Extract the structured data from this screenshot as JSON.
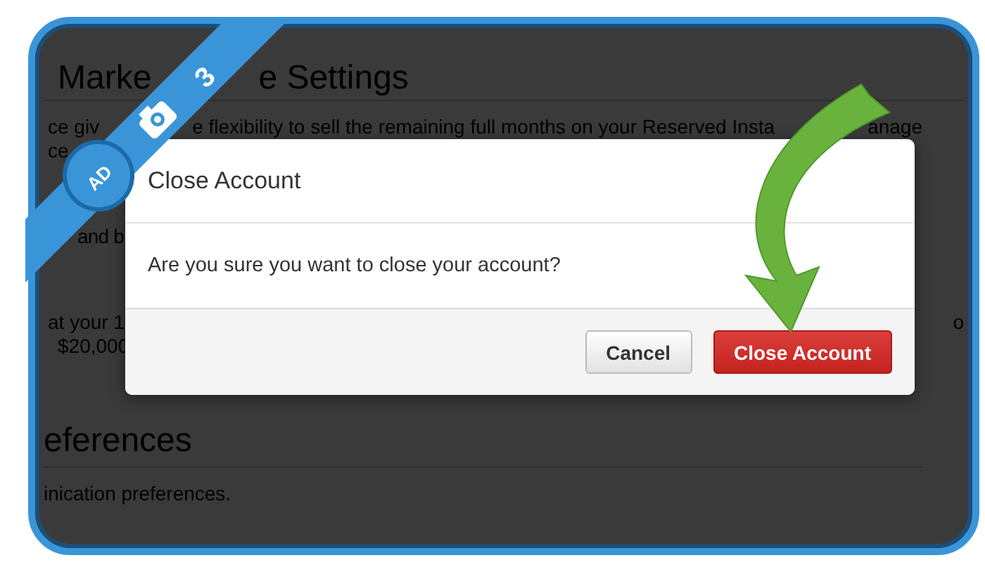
{
  "background_page": {
    "heading_fragments": [
      "Marke",
      "e Settings"
    ],
    "line_1_fragments": [
      "ce giv",
      "e flexibility to sell the remaining full months on your Reserved Insta",
      "anage"
    ],
    "line_2_fragments": [
      "ce"
    ],
    "line_3_fragments": [
      "and b"
    ],
    "line_4_fragments": [
      "at your 1",
      "o"
    ],
    "line_5_fragments": [
      "$20,000"
    ],
    "section_heading": "eferences",
    "section_text": "inication preferences."
  },
  "dialog": {
    "title": "Close Account",
    "message": "Are you sure you want to close your account?",
    "buttons": [
      {
        "label": "Cancel",
        "kind": "secondary"
      },
      {
        "label": "Close Account",
        "kind": "danger"
      }
    ]
  },
  "ribbon": {
    "count": "3",
    "badge": "AD"
  }
}
